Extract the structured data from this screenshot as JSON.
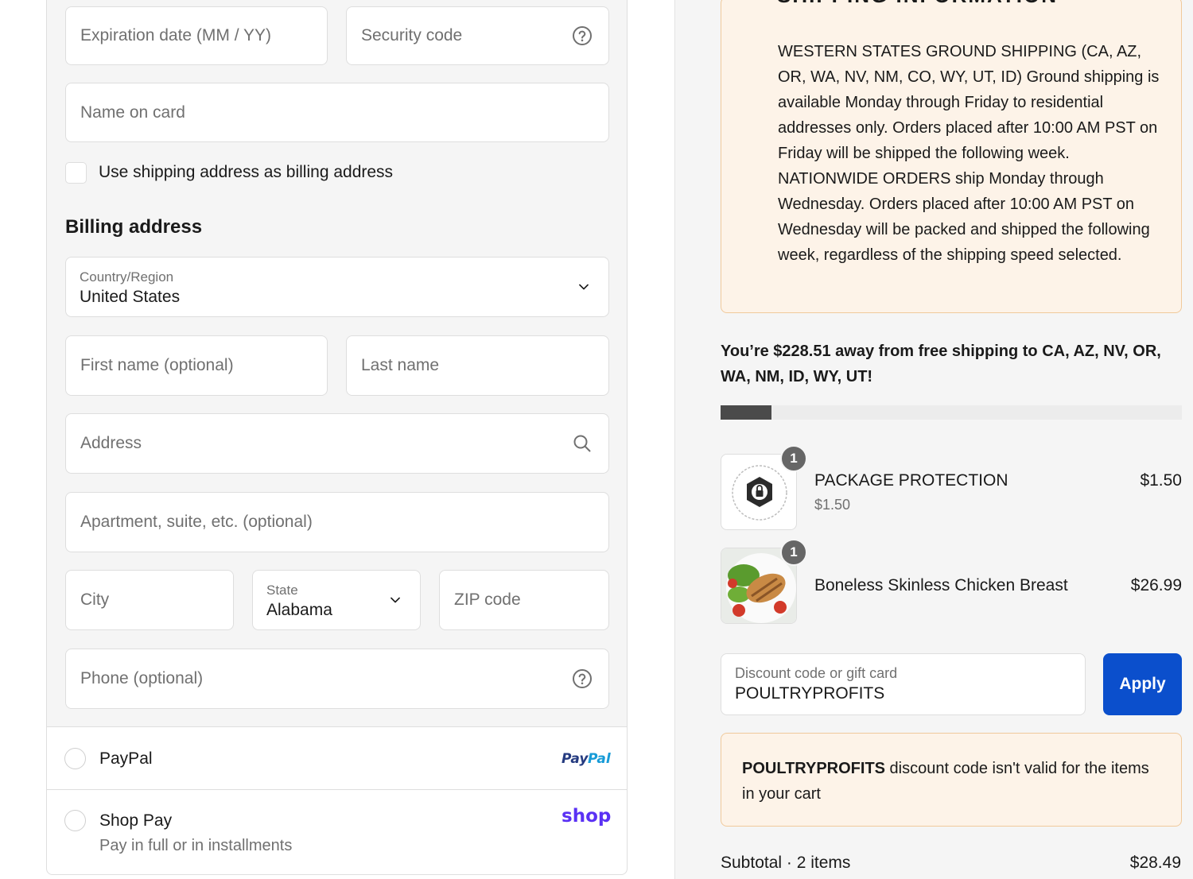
{
  "payment_card": {
    "expiration_placeholder": "Expiration date (MM / YY)",
    "security_code_placeholder": "Security code",
    "name_on_card_placeholder": "Name on card",
    "use_shipping_as_billing_label": "Use shipping address as billing address",
    "use_shipping_as_billing_checked": false
  },
  "billing": {
    "title": "Billing address",
    "country_label": "Country/Region",
    "country_value": "United States",
    "first_name_placeholder": "First name (optional)",
    "last_name_placeholder": "Last name",
    "address_placeholder": "Address",
    "apartment_placeholder": "Apartment, suite, etc. (optional)",
    "city_placeholder": "City",
    "state_label": "State",
    "state_value": "Alabama",
    "zip_placeholder": "ZIP code",
    "phone_placeholder": "Phone (optional)"
  },
  "payment_options": [
    {
      "label": "PayPal",
      "brand_text": "PayPal",
      "brand_color": "#253b80",
      "brand_color_2": "#179bd7"
    },
    {
      "label": "Shop Pay",
      "sublabel": "Pay in full or in installments",
      "brand_text": "shop",
      "brand_color": "#5a31f4"
    }
  ],
  "shipping_info": {
    "heading": "SHIPPING INFORMATION",
    "text": "WESTERN STATES GROUND SHIPPING (CA, AZ, OR, WA, NV, NM, CO, WY, UT, ID) Ground shipping is available Monday through Friday to residential addresses only. Orders placed after 10:00 AM PST on Friday will be shipped the following week. NATIONWIDE ORDERS ship Monday through Wednesday. Orders placed after 10:00 AM PST on Wednesday will be packed and shipped the following week, regardless of the shipping speed selected."
  },
  "free_shipping": {
    "message": "You’re $228.51 away from free shipping to CA, AZ, NV, OR, WA, NM, ID, WY, UT!",
    "progress_fraction": 0.11
  },
  "cart_items": [
    {
      "name": "PACKAGE PROTECTION",
      "unit_price": "$1.50",
      "price": "$1.50",
      "quantity": "1"
    },
    {
      "name": "Boneless Skinless Chicken Breast",
      "price": "$26.99",
      "quantity": "1"
    }
  ],
  "discount": {
    "label": "Discount code or gift card",
    "value": "POULTRYPROFITS",
    "apply_label": "Apply",
    "error_code": "POULTRYPROFITS",
    "error_message": " discount code isn't valid for the items in your cart"
  },
  "summary": {
    "subtotal_label": "Subtotal · 2 items",
    "subtotal_value": "$28.49"
  },
  "colors": {
    "accent": "#0b4fcc",
    "notice_bg": "#fdf3e8",
    "notice_border": "#f0c99b"
  }
}
